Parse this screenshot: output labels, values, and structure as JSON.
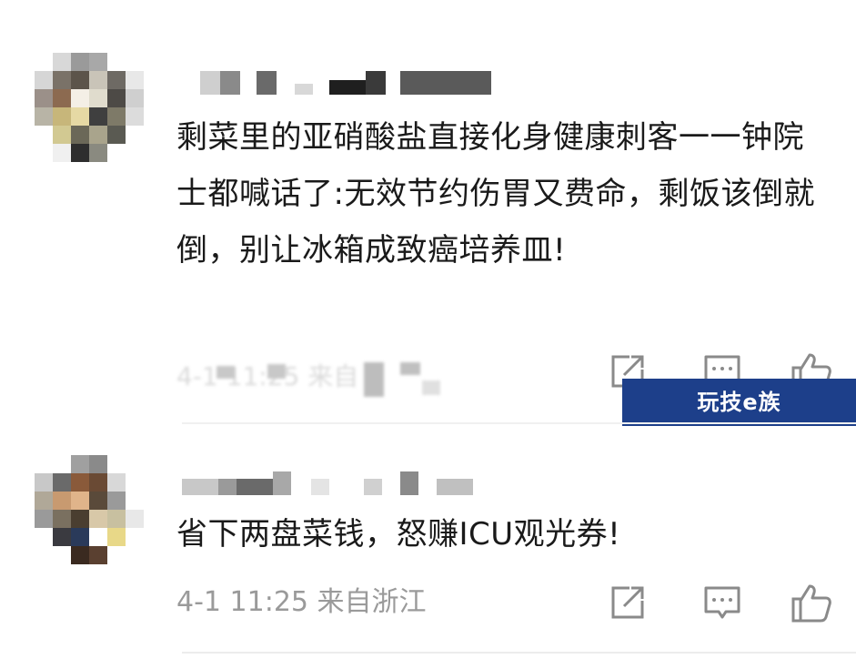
{
  "comments": [
    {
      "text": "剩菜里的亚硝酸盐直接化身健康刺客一一钟院士都喊话了:无效节约伤胃又费命，剩饭该倒就倒，别让冰箱成致癌培养皿!",
      "meta": "4-1 11:25 来自",
      "avatar_icon": "pixelated-avatar",
      "share_icon": "share-icon",
      "comment_icon": "comment-icon",
      "like_icon": "thumbs-up-icon"
    },
    {
      "text": "省下两盘菜钱，怒赚ICU观光券!",
      "meta": "4-1 11:25 来自浙江",
      "avatar_icon": "pixelated-avatar",
      "share_icon": "share-icon",
      "comment_icon": "comment-icon",
      "like_icon": "thumbs-up-icon"
    }
  ],
  "watermark": "玩技e族",
  "colors": {
    "text": "#1a1a1a",
    "meta": "#9a9a9a",
    "icon": "#8a8a8a",
    "watermark_bg": "#1d3f8a"
  }
}
